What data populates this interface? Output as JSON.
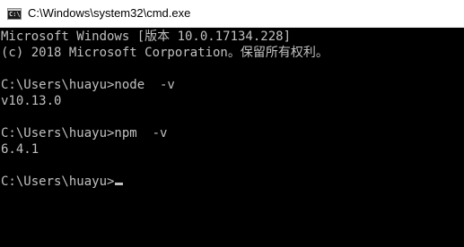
{
  "window": {
    "title": "C:\\Windows\\system32\\cmd.exe",
    "icon": "cmd-icon",
    "icon_glyph": "C:\\"
  },
  "console": {
    "lines": [
      "Microsoft Windows [版本 10.0.17134.228]",
      "(c) 2018 Microsoft Corporation。保留所有权利。",
      "",
      "C:\\Users\\huayu>node  -v",
      "v10.13.0",
      "",
      "C:\\Users\\huayu>npm  -v",
      "6.4.1",
      "",
      "C:\\Users\\huayu>"
    ]
  },
  "colors": {
    "background": "#000000",
    "text": "#c0c0c0",
    "titlebar": "#ffffff"
  }
}
